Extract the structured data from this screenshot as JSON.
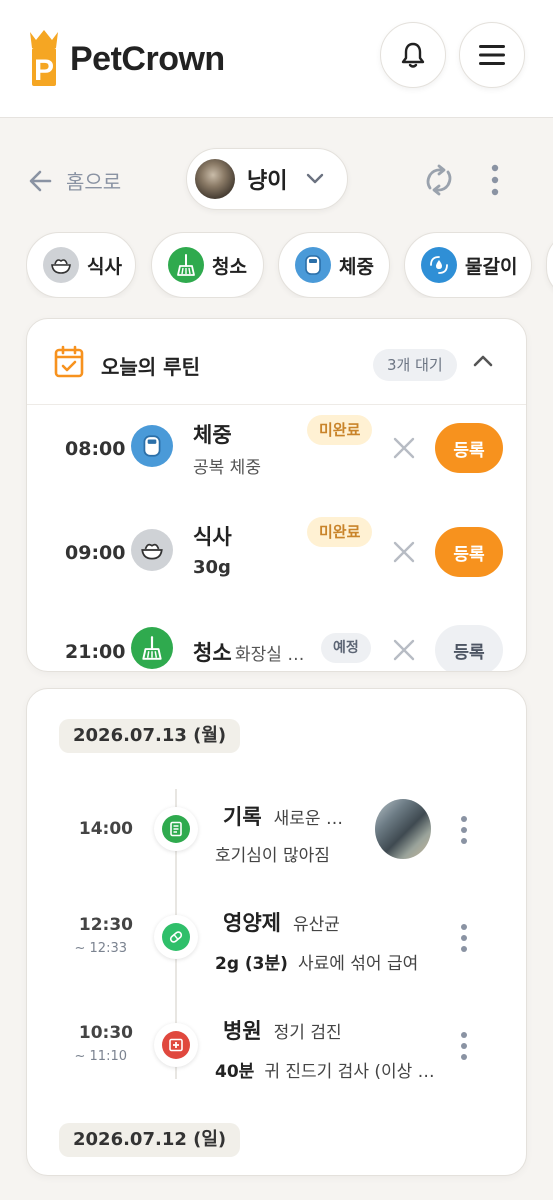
{
  "header": {
    "brand": "PetCrown",
    "logo_letter": "P",
    "accent": "#f5a623"
  },
  "topbar": {
    "back_label": "홈으로",
    "pet_name": "냥이"
  },
  "chips": [
    {
      "label": "식사",
      "icon": "bowl-icon",
      "color": "#c9ccd1"
    },
    {
      "label": "청소",
      "icon": "broom-icon",
      "color": "#2faa4e"
    },
    {
      "label": "체중",
      "icon": "scale-icon",
      "color": "#4a9ad8"
    },
    {
      "label": "물갈이",
      "icon": "water-refresh-icon",
      "color": "#2f8fd6"
    }
  ],
  "routine": {
    "title": "오늘의 루틴",
    "pending": "3개 대기",
    "items": [
      {
        "time": "08:00",
        "title": "체중",
        "sub": "공복 체중",
        "badge": "미완료",
        "action": "등록"
      },
      {
        "time": "09:00",
        "title": "식사",
        "sub": "30g",
        "badge": "미완료",
        "action": "등록"
      },
      {
        "time": "21:00",
        "title": "청소",
        "sub": "화장실 …",
        "badge": "예정",
        "action": "등록"
      }
    ]
  },
  "timeline": {
    "dates": [
      "2026.07.13 (월)",
      "2026.07.12 (일)"
    ],
    "entries": [
      {
        "time": "14:00",
        "end": "",
        "title": "기록",
        "title_sub": "새로운 …",
        "detail_strong": "",
        "detail": "호기심이 많아짐"
      },
      {
        "time": "12:30",
        "end": "~ 12:33",
        "title": "영양제",
        "title_sub": "유산균",
        "detail_strong": "2g (3분)",
        "detail": "사료에 섞어 급여"
      },
      {
        "time": "10:30",
        "end": "~ 11:10",
        "title": "병원",
        "title_sub": "정기 검진",
        "detail_strong": "40분",
        "detail": "귀 진드기 검사 (이상 …"
      }
    ]
  }
}
